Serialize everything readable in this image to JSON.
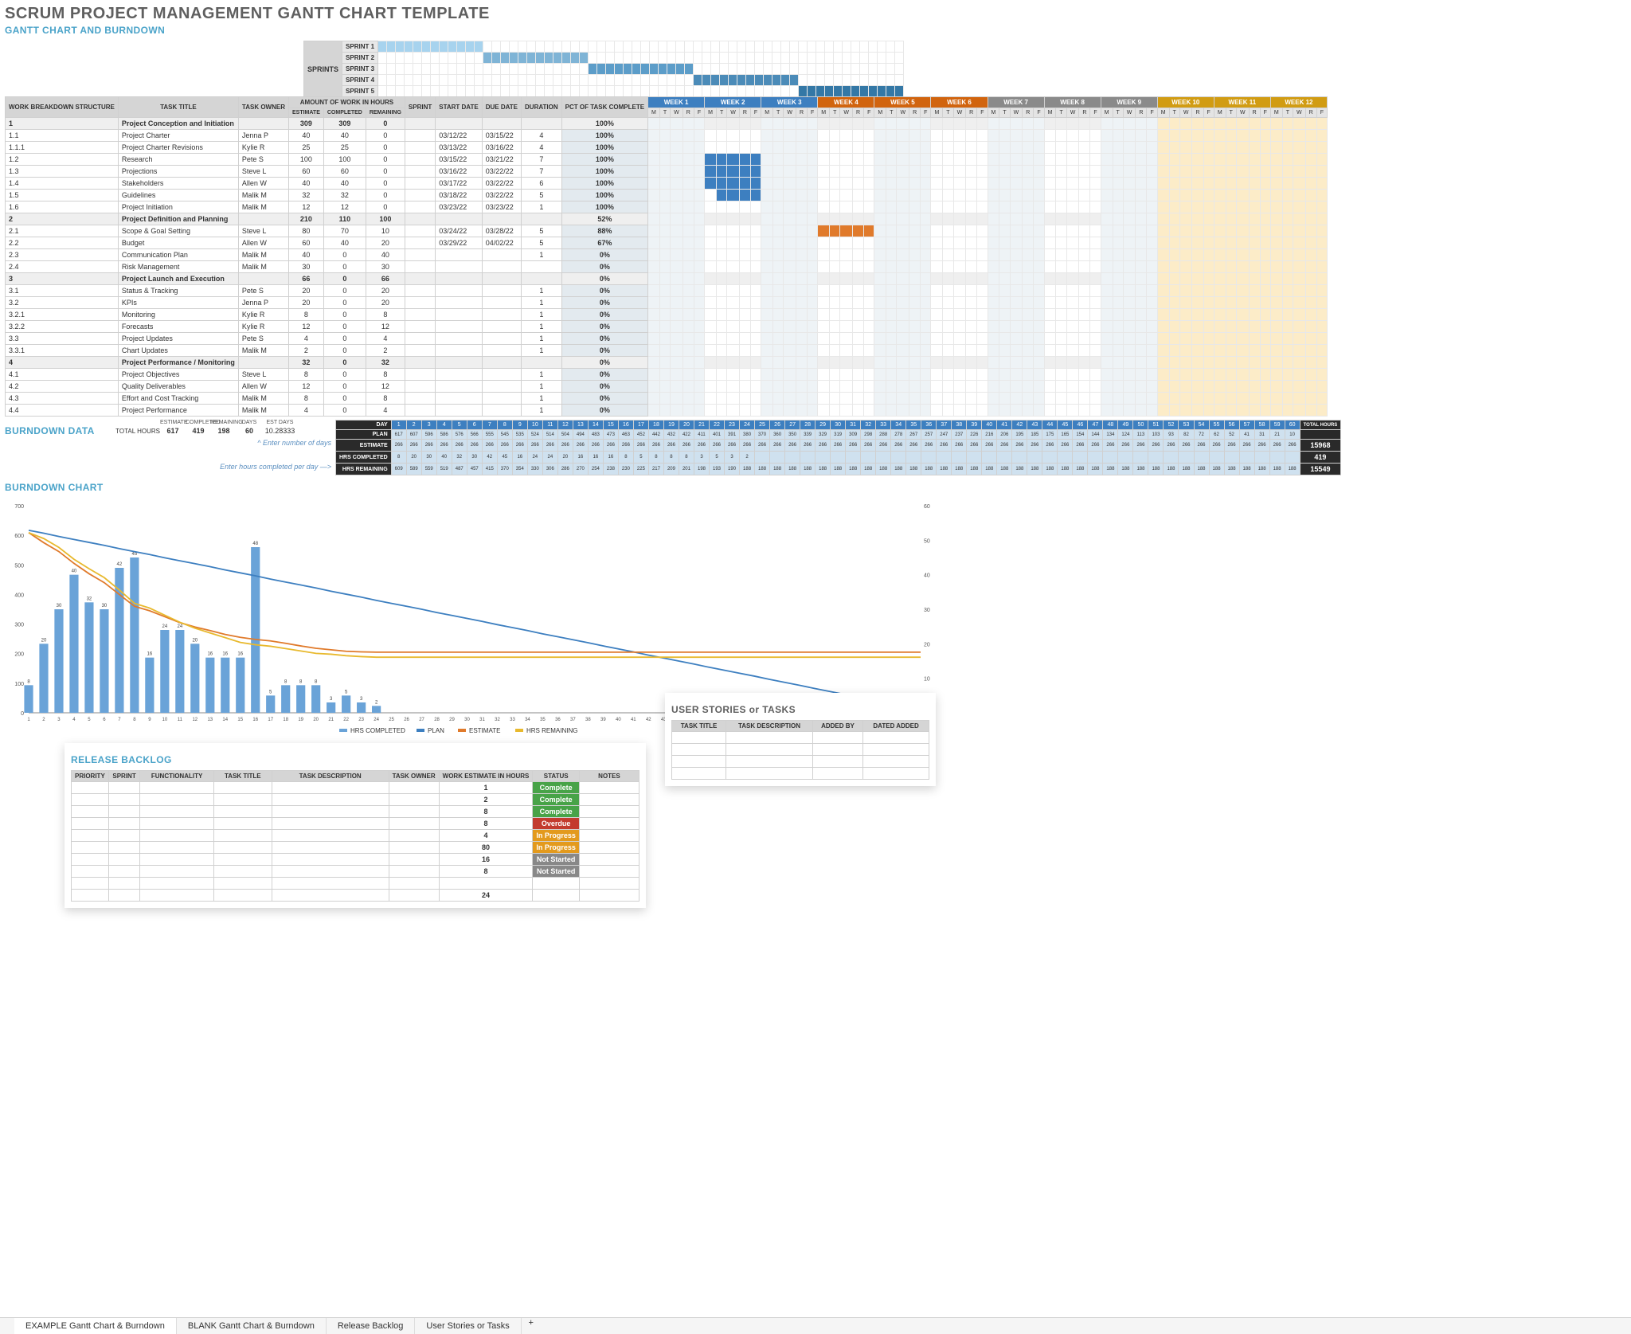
{
  "titles": {
    "main": "SCRUM PROJECT MANAGEMENT GANTT CHART TEMPLATE",
    "gantt": "GANTT CHART AND BURNDOWN",
    "burndown_data": "BURNDOWN DATA",
    "burndown_chart": "BURNDOWN CHART",
    "release_backlog": "RELEASE BACKLOG",
    "user_stories": "USER STORIES or TASKS"
  },
  "sprint_header": {
    "label": "SPRINTS",
    "rows": [
      "SPRINT 1",
      "SPRINT 2",
      "SPRINT 3",
      "SPRINT 4",
      "SPRINT 5"
    ]
  },
  "task_cols": {
    "wbs": "WORK BREAKDOWN STRUCTURE",
    "title": "TASK TITLE",
    "owner": "TASK OWNER",
    "hours": "AMOUNT OF WORK IN HOURS",
    "est": "ESTIMATE",
    "comp": "COMPLETED",
    "rem": "REMAINING",
    "sprint": "SPRINT",
    "start": "START DATE",
    "due": "DUE DATE",
    "dur": "DURATION",
    "pct": "PCT OF TASK COMPLETE"
  },
  "weeks": [
    {
      "label": "WEEK 1",
      "color": "blue"
    },
    {
      "label": "WEEK 2",
      "color": "blue"
    },
    {
      "label": "WEEK 3",
      "color": "blue"
    },
    {
      "label": "WEEK 4",
      "color": "orange"
    },
    {
      "label": "WEEK 5",
      "color": "orange"
    },
    {
      "label": "WEEK 6",
      "color": "orange"
    },
    {
      "label": "WEEK 7",
      "color": "gray"
    },
    {
      "label": "WEEK 8",
      "color": "gray"
    },
    {
      "label": "WEEK 9",
      "color": "gray"
    },
    {
      "label": "WEEK 10",
      "color": "gold"
    },
    {
      "label": "WEEK 11",
      "color": "gold"
    },
    {
      "label": "WEEK 12",
      "color": "gold"
    }
  ],
  "day_letters": [
    "M",
    "T",
    "W",
    "R",
    "F"
  ],
  "tasks": [
    {
      "wbs": "1",
      "title": "Project Conception and Initiation",
      "owner": "",
      "est": 309,
      "comp": 309,
      "rem": 0,
      "sprint": "",
      "start": "",
      "due": "",
      "dur": "",
      "pct": "100%",
      "group": true,
      "bar_start": 0,
      "bar_len": 0,
      "color": 1
    },
    {
      "wbs": "1.1",
      "title": "Project Charter",
      "owner": "Jenna P",
      "est": 40,
      "comp": 40,
      "rem": 0,
      "start": "03/12/22",
      "due": "03/15/22",
      "dur": 4,
      "pct": "100%",
      "bar_start": 0,
      "bar_len": 4,
      "color": 1
    },
    {
      "wbs": "1.1.1",
      "title": "Project Charter Revisions",
      "owner": "Kylie R",
      "est": 25,
      "comp": 25,
      "rem": 0,
      "start": "03/13/22",
      "due": "03/16/22",
      "dur": 4,
      "pct": "100%",
      "bar_start": 1,
      "bar_len": 4,
      "color": 1
    },
    {
      "wbs": "1.2",
      "title": "Research",
      "owner": "Pete S",
      "est": 100,
      "comp": 100,
      "rem": 0,
      "start": "03/15/22",
      "due": "03/21/22",
      "dur": 7,
      "pct": "100%",
      "bar_start": 3,
      "bar_len": 7,
      "color": 1
    },
    {
      "wbs": "1.3",
      "title": "Projections",
      "owner": "Steve L",
      "est": 60,
      "comp": 60,
      "rem": 0,
      "start": "03/16/22",
      "due": "03/22/22",
      "dur": 7,
      "pct": "100%",
      "bar_start": 4,
      "bar_len": 7,
      "color": 1
    },
    {
      "wbs": "1.4",
      "title": "Stakeholders",
      "owner": "Allen W",
      "est": 40,
      "comp": 40,
      "rem": 0,
      "start": "03/17/22",
      "due": "03/22/22",
      "dur": 6,
      "pct": "100%",
      "bar_start": 5,
      "bar_len": 6,
      "color": 1
    },
    {
      "wbs": "1.5",
      "title": "Guidelines",
      "owner": "Malik M",
      "est": 32,
      "comp": 32,
      "rem": 0,
      "start": "03/18/22",
      "due": "03/22/22",
      "dur": 5,
      "pct": "100%",
      "bar_start": 6,
      "bar_len": 5,
      "color": 1
    },
    {
      "wbs": "1.6",
      "title": "Project Initiation",
      "owner": "Malik M",
      "est": 12,
      "comp": 12,
      "rem": 0,
      "start": "03/23/22",
      "due": "03/23/22",
      "dur": 1,
      "pct": "100%",
      "bar_start": 11,
      "bar_len": 1,
      "color": 1
    },
    {
      "wbs": "2",
      "title": "Project Definition and Planning",
      "owner": "",
      "est": 210,
      "comp": 110,
      "rem": 100,
      "pct": "52%",
      "group": true
    },
    {
      "wbs": "2.1",
      "title": "Scope & Goal Setting",
      "owner": "Steve L",
      "est": 80,
      "comp": 70,
      "rem": 10,
      "start": "03/24/22",
      "due": "03/28/22",
      "dur": 5,
      "pct": "88%",
      "bar_start": 15,
      "bar_len": 5,
      "color": 2
    },
    {
      "wbs": "2.2",
      "title": "Budget",
      "owner": "Allen W",
      "est": 60,
      "comp": 40,
      "rem": 20,
      "start": "03/29/22",
      "due": "04/02/22",
      "dur": 5,
      "pct": "67%",
      "bar_start": 20,
      "bar_len": 5,
      "color": 2
    },
    {
      "wbs": "2.3",
      "title": "Communication Plan",
      "owner": "Malik M",
      "est": 40,
      "comp": 0,
      "rem": 40,
      "dur": 1,
      "pct": "0%"
    },
    {
      "wbs": "2.4",
      "title": "Risk Management",
      "owner": "Malik M",
      "est": 30,
      "comp": 0,
      "rem": 30,
      "dur": "",
      "pct": "0%"
    },
    {
      "wbs": "3",
      "title": "Project Launch and Execution",
      "owner": "",
      "est": 66,
      "comp": 0,
      "rem": 66,
      "pct": "0%",
      "group": true
    },
    {
      "wbs": "3.1",
      "title": "Status & Tracking",
      "owner": "Pete S",
      "est": 20,
      "comp": 0,
      "rem": 20,
      "dur": 1,
      "pct": "0%"
    },
    {
      "wbs": "3.2",
      "title": "KPIs",
      "owner": "Jenna P",
      "est": 20,
      "comp": 0,
      "rem": 20,
      "dur": 1,
      "pct": "0%"
    },
    {
      "wbs": "3.2.1",
      "title": "Monitoring",
      "owner": "Kylie R",
      "est": 8,
      "comp": 0,
      "rem": 8,
      "dur": 1,
      "pct": "0%"
    },
    {
      "wbs": "3.2.2",
      "title": "Forecasts",
      "owner": "Kylie R",
      "est": 12,
      "comp": 0,
      "rem": 12,
      "dur": 1,
      "pct": "0%"
    },
    {
      "wbs": "3.3",
      "title": "Project Updates",
      "owner": "Pete S",
      "est": 4,
      "comp": 0,
      "rem": 4,
      "dur": 1,
      "pct": "0%"
    },
    {
      "wbs": "3.3.1",
      "title": "Chart Updates",
      "owner": "Malik M",
      "est": 2,
      "comp": 0,
      "rem": 2,
      "dur": 1,
      "pct": "0%"
    },
    {
      "wbs": "4",
      "title": "Project Performance / Monitoring",
      "owner": "",
      "est": 32,
      "comp": 0,
      "rem": 32,
      "pct": "0%",
      "group": true
    },
    {
      "wbs": "4.1",
      "title": "Project Objectives",
      "owner": "Steve L",
      "est": 8,
      "comp": 0,
      "rem": 8,
      "dur": 1,
      "pct": "0%"
    },
    {
      "wbs": "4.2",
      "title": "Quality Deliverables",
      "owner": "Allen W",
      "est": 12,
      "comp": 0,
      "rem": 12,
      "dur": 1,
      "pct": "0%"
    },
    {
      "wbs": "4.3",
      "title": "Effort and Cost Tracking",
      "owner": "Malik M",
      "est": 8,
      "comp": 0,
      "rem": 8,
      "dur": 1,
      "pct": "0%"
    },
    {
      "wbs": "4.4",
      "title": "Project Performance",
      "owner": "Malik M",
      "est": 4,
      "comp": 0,
      "rem": 4,
      "dur": 1,
      "pct": "0%"
    }
  ],
  "totals": {
    "label": "TOTAL HOURS",
    "est": 617,
    "comp": 419,
    "rem": 198,
    "days_label": "DAYS",
    "days": 60,
    "estdays_label": "EST DAYS",
    "estdays": "10.28333",
    "col_labels": [
      "ESTIMATE",
      "COMPLETED",
      "REMAINING"
    ]
  },
  "help": {
    "enter_days": "^ Enter number of days",
    "enter_hours": "Enter hours completed per day —>"
  },
  "burndown": {
    "cols": [
      "DAY",
      "PLAN",
      "ESTIMATE",
      "HRS COMPLETED",
      "HRS REMAINING"
    ],
    "totals_label": "TOTAL HOURS",
    "totals": {
      "plan": "",
      "estimate": 15968,
      "completed": 419,
      "remaining": 15549
    },
    "days": 60,
    "plan_row_sample": [
      617,
      607,
      596,
      586,
      576,
      566,
      555,
      545,
      535,
      524,
      514,
      504,
      494,
      483,
      473,
      463,
      452,
      442,
      432,
      422,
      411,
      401,
      391,
      380,
      370,
      360,
      350,
      339,
      329,
      319,
      309,
      298,
      288,
      278,
      267,
      257,
      247,
      237,
      226,
      216,
      206,
      195,
      185,
      175,
      165,
      154,
      144,
      134,
      124,
      113,
      103,
      93,
      82,
      72,
      62,
      52,
      41,
      31,
      21,
      10
    ],
    "estimate_row": 266,
    "hrs_completed_sample": [
      8,
      20,
      30,
      40,
      32,
      30,
      42,
      45,
      16,
      24,
      24,
      20,
      16,
      16,
      16,
      8,
      5,
      8,
      8,
      8,
      3,
      5,
      3,
      2,
      "",
      "",
      "",
      "",
      "",
      "",
      "",
      "",
      "",
      "",
      "",
      "",
      "",
      "",
      "",
      "",
      "",
      "",
      "",
      "",
      "",
      "",
      "",
      "",
      "",
      "",
      "",
      "",
      "",
      "",
      "",
      "",
      "",
      "",
      "",
      ""
    ],
    "hrs_remaining_row_sample": [
      609,
      589,
      559,
      519,
      487,
      457,
      415,
      370,
      354,
      330,
      306,
      286,
      270,
      254,
      238,
      230,
      225,
      217,
      209,
      201,
      198,
      193,
      190,
      188,
      188,
      188,
      188,
      188,
      188,
      188,
      188,
      188,
      188,
      188,
      188,
      188,
      188,
      188,
      188,
      188,
      188,
      188,
      188,
      188,
      188,
      188,
      188,
      188,
      188,
      188,
      188,
      188,
      188,
      188,
      188,
      188,
      188,
      188,
      188,
      188
    ]
  },
  "chart_data": {
    "type": "combo",
    "title": "",
    "x": [
      1,
      2,
      3,
      4,
      5,
      6,
      7,
      8,
      9,
      10,
      11,
      12,
      13,
      14,
      15,
      16,
      17,
      18,
      19,
      20,
      21,
      22,
      23,
      24,
      25,
      26,
      27,
      28,
      29,
      30,
      31,
      32,
      33,
      34,
      35,
      36,
      37,
      38,
      39,
      40,
      41,
      42,
      43,
      44,
      45,
      46,
      47,
      48,
      49,
      50,
      51,
      52,
      53,
      54,
      55,
      56,
      57,
      58,
      59,
      60
    ],
    "y_left_lim": [
      0,
      700
    ],
    "y_right_lim": [
      0,
      60
    ],
    "series": [
      {
        "name": "HRS COMPLETED",
        "type": "bar",
        "axis": "right",
        "values": [
          8,
          20,
          30,
          40,
          32,
          30,
          42,
          45,
          16,
          24,
          24,
          20,
          16,
          16,
          16,
          48,
          5,
          8,
          8,
          8,
          3,
          5,
          3,
          2,
          0,
          0,
          0,
          0,
          0,
          0,
          0,
          0,
          0,
          0,
          0,
          0,
          0,
          0,
          0,
          0,
          0,
          0,
          0,
          0,
          0,
          0,
          0,
          0,
          0,
          0,
          0,
          0,
          0,
          0,
          0,
          0,
          0,
          0,
          0,
          0
        ]
      },
      {
        "name": "PLAN",
        "type": "line",
        "axis": "left",
        "values": [
          617,
          607,
          596,
          586,
          576,
          566,
          555,
          545,
          535,
          524,
          514,
          504,
          494,
          483,
          473,
          463,
          452,
          442,
          432,
          422,
          411,
          401,
          391,
          380,
          370,
          360,
          350,
          339,
          329,
          319,
          309,
          298,
          288,
          278,
          267,
          257,
          247,
          237,
          226,
          216,
          206,
          195,
          185,
          175,
          165,
          154,
          144,
          134,
          124,
          113,
          103,
          93,
          82,
          72,
          62,
          52,
          41,
          31,
          21,
          10
        ]
      },
      {
        "name": "ESTIMATE",
        "type": "line",
        "axis": "left",
        "values": [
          609,
          575,
          545,
          505,
          470,
          440,
          400,
          360,
          345,
          325,
          305,
          290,
          278,
          265,
          255,
          248,
          243,
          235,
          226,
          218,
          213,
          208,
          206,
          205,
          205,
          205,
          205,
          205,
          205,
          205,
          205,
          205,
          205,
          205,
          205,
          205,
          205,
          205,
          205,
          205,
          205,
          205,
          205,
          205,
          205,
          205,
          205,
          205,
          205,
          205,
          205,
          205,
          205,
          205,
          205,
          205,
          205,
          205,
          205,
          205
        ]
      },
      {
        "name": "HRS REMAINING",
        "type": "line",
        "axis": "left",
        "values": [
          609,
          589,
          559,
          519,
          487,
          457,
          415,
          370,
          354,
          330,
          306,
          286,
          270,
          254,
          238,
          230,
          225,
          217,
          209,
          201,
          198,
          193,
          190,
          188,
          188,
          188,
          188,
          188,
          188,
          188,
          188,
          188,
          188,
          188,
          188,
          188,
          188,
          188,
          188,
          188,
          188,
          188,
          188,
          188,
          188,
          188,
          188,
          188,
          188,
          188,
          188,
          188,
          188,
          188,
          188,
          188,
          188,
          188,
          188,
          188
        ]
      }
    ],
    "legend": [
      "HRS COMPLETED",
      "PLAN",
      "ESTIMATE",
      "HRS REMAINING"
    ]
  },
  "backlog_cols": [
    "PRIORITY",
    "SPRINT",
    "FUNCTIONALITY",
    "TASK TITLE",
    "TASK DESCRIPTION",
    "TASK OWNER",
    "WORK ESTIMATE IN HOURS",
    "STATUS",
    "NOTES"
  ],
  "backlog_rows": [
    {
      "hours": 1,
      "status": "Complete",
      "statusClass": "green"
    },
    {
      "hours": 2,
      "status": "Complete",
      "statusClass": "green"
    },
    {
      "hours": 8,
      "status": "Complete",
      "statusClass": "green"
    },
    {
      "hours": 8,
      "status": "Overdue",
      "statusClass": "red"
    },
    {
      "hours": 4,
      "status": "In Progress",
      "statusClass": "yell"
    },
    {
      "hours": 80,
      "status": "In Progress",
      "statusClass": "yell"
    },
    {
      "hours": 16,
      "status": "Not Started",
      "statusClass": "gray"
    },
    {
      "hours": 8,
      "status": "Not Started",
      "statusClass": "gray"
    },
    {
      "hours": "",
      "status": "",
      "statusClass": ""
    },
    {
      "hours": 24,
      "status": "",
      "statusClass": ""
    }
  ],
  "user_stories_cols": [
    "TASK TITLE",
    "TASK DESCRIPTION",
    "ADDED BY",
    "DATED ADDED"
  ],
  "tabs": [
    "EXAMPLE Gantt Chart & Burndown",
    "BLANK Gantt Chart & Burndown",
    "Release Backlog",
    "User Stories or Tasks"
  ],
  "active_tab": 0
}
